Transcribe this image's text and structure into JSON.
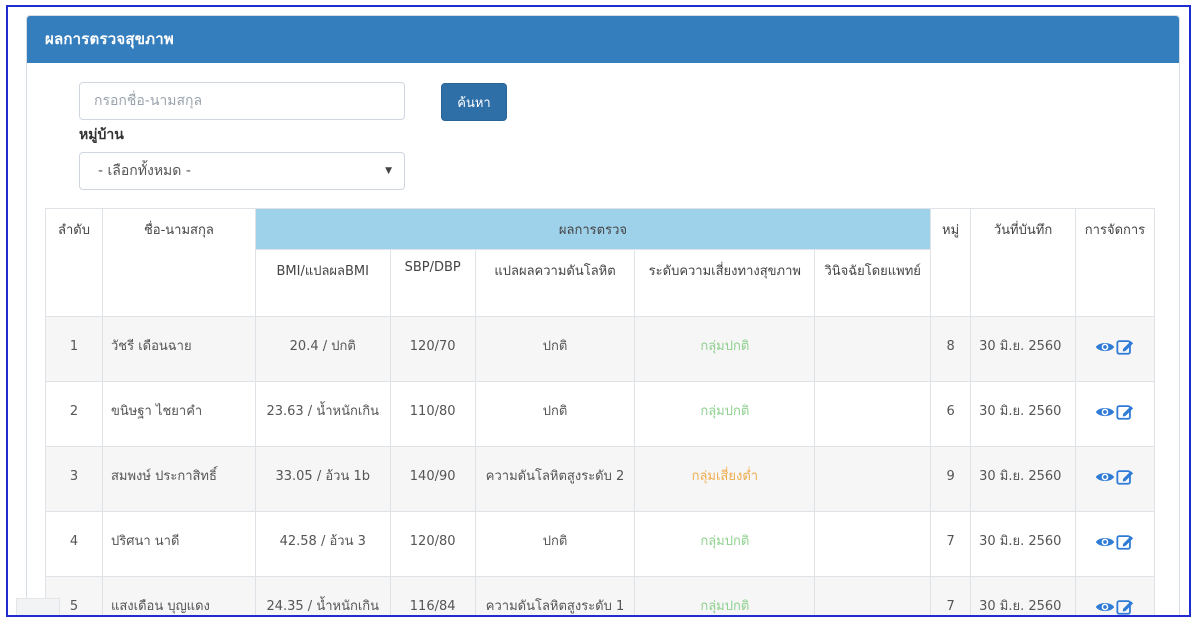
{
  "panel": {
    "title": "ผลการตรวจสุขภาพ"
  },
  "search": {
    "placeholder": "กรอกชื่อ-นามสกุล",
    "button_label": "ค้นหา"
  },
  "village": {
    "label": "หมู่บ้าน",
    "selected": "- เลือกทั้งหมด -"
  },
  "table": {
    "headers": {
      "no": "ลำดับ",
      "name": "ชื่อ-นามสกุล",
      "results_group": "ผลการตรวจ",
      "village": "หมู่",
      "date": "วันที่บันทึก",
      "manage": "การจัดการ"
    },
    "subheaders": {
      "bmi": "BMI/แปลผลBMI",
      "sbp": "SBP/DBP",
      "bp_result": "แปลผลความดันโลหิต",
      "risk": "ระดับความเสี่ยงทางสุขภาพ",
      "diagnosis": "วินิจฉัยโดยแพทย์"
    },
    "rows": [
      {
        "no": "1",
        "name": "วัชรี เดือนฉาย",
        "bmi": "20.4 / ปกติ",
        "sbp": "120/70",
        "bp_result": "ปกติ",
        "risk": "กลุ่มปกติ",
        "diagnosis": "",
        "village": "8",
        "date": "30 มิ.ย. 2560"
      },
      {
        "no": "2",
        "name": "ขนิษฐา ไชยาคำ",
        "bmi": "23.63 / น้ำหนักเกิน",
        "sbp": "110/80",
        "bp_result": "ปกติ",
        "risk": "กลุ่มปกติ",
        "diagnosis": "",
        "village": "6",
        "date": "30 มิ.ย. 2560"
      },
      {
        "no": "3",
        "name": "สมพงษ์ ประกาสิทธิ์",
        "bmi": "33.05 / อ้วน 1b",
        "sbp": "140/90",
        "bp_result": "ความดันโลหิตสูงระดับ 2",
        "risk": "กลุ่มเสี่ยงต่ำ",
        "diagnosis": "",
        "village": "9",
        "date": "30 มิ.ย. 2560"
      },
      {
        "no": "4",
        "name": "ปริศนา นาดี",
        "bmi": "42.58 / อ้วน 3",
        "sbp": "120/80",
        "bp_result": "ปกติ",
        "risk": "กลุ่มปกติ",
        "diagnosis": "",
        "village": "7",
        "date": "30 มิ.ย. 2560"
      },
      {
        "no": "5",
        "name": "แสงเดือน บุญแดง",
        "bmi": "24.35 / น้ำหนักเกิน",
        "sbp": "116/84",
        "bp_result": "ความดันโลหิตสูงระดับ 1",
        "risk": "กลุ่มปกติ",
        "diagnosis": "",
        "village": "7",
        "date": "30 มิ.ย. 2560"
      }
    ]
  },
  "colors": {
    "header_bg": "#357ebd",
    "group_header_bg": "#9ed1ea",
    "button_bg": "#2f6fa8",
    "risk_normal": "#8fd08f",
    "risk_low": "#f0ad4e",
    "icon_blue": "#2f7bd6"
  },
  "icons": {
    "view": "eye-icon",
    "edit": "edit-icon",
    "select_caret": "caret-down-icon"
  }
}
